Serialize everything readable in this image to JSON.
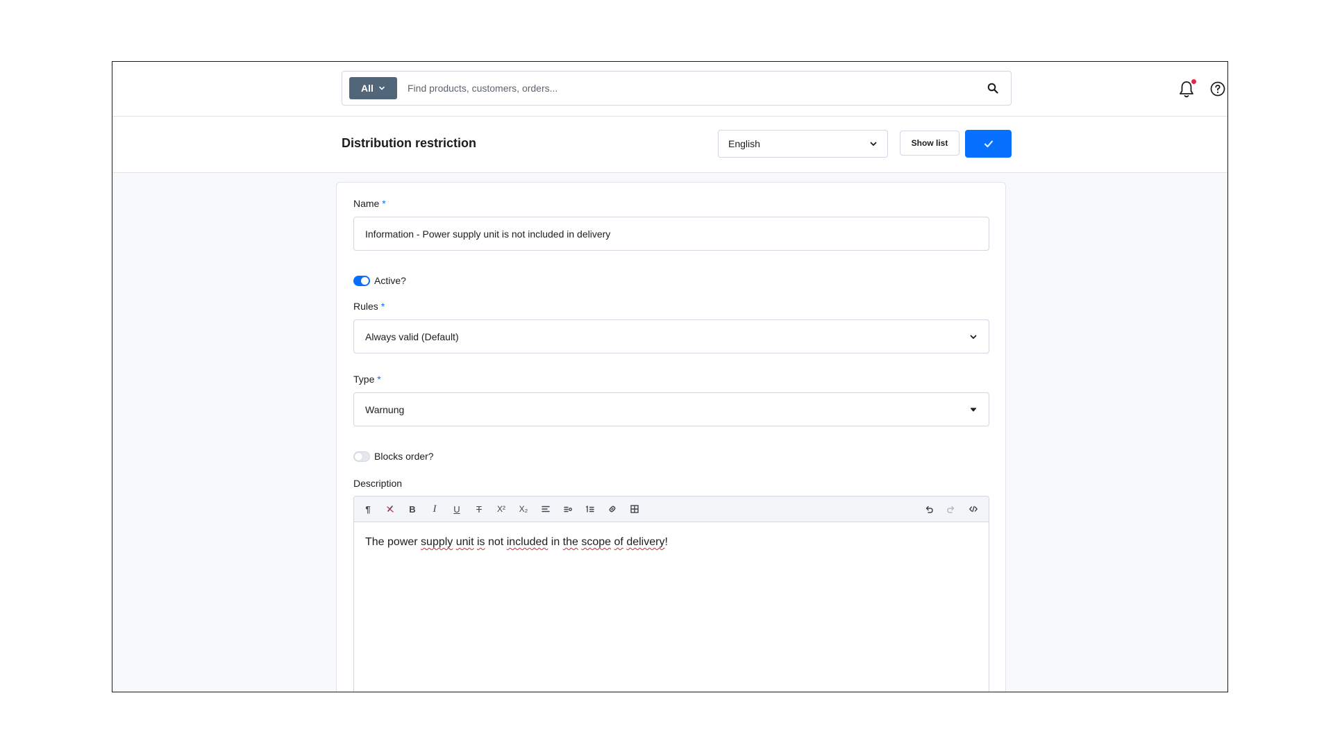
{
  "search": {
    "scope_label": "All",
    "placeholder": "Find products, customers, orders..."
  },
  "header": {
    "title": "Distribution restriction",
    "language": "English",
    "show_list_label": "Show list"
  },
  "form": {
    "name_label": "Name",
    "name_required": "*",
    "name_value": "Information - Power supply unit is not included in delivery",
    "active_label": "Active?",
    "active_on": true,
    "rules_label": "Rules",
    "rules_required": "*",
    "rules_value": "Always valid (Default)",
    "type_label": "Type",
    "type_required": "*",
    "type_value": "Warnung",
    "blocks_order_label": "Blocks order?",
    "blocks_order_on": false,
    "description_label": "Description",
    "description": {
      "w1": "The power ",
      "w2": "supply",
      "w3": " ",
      "w4": "unit",
      "w5": " ",
      "w6": "is",
      "w7": " not ",
      "w8": "included",
      "w9": " in ",
      "w10": "the",
      "w11": " ",
      "w12": "scope",
      "w13": " ",
      "w14": "of",
      "w15": " ",
      "w16": "delivery",
      "w17": "!"
    }
  },
  "toolbar": {
    "paragraph": "¶",
    "bold": "B",
    "italic": "I",
    "underline": "U",
    "strikethrough": "T",
    "superscript": "X²",
    "subscript": "X₂"
  },
  "colors": {
    "primary": "#0870ff",
    "notification": "#de294c",
    "scope_button": "#52667a"
  }
}
